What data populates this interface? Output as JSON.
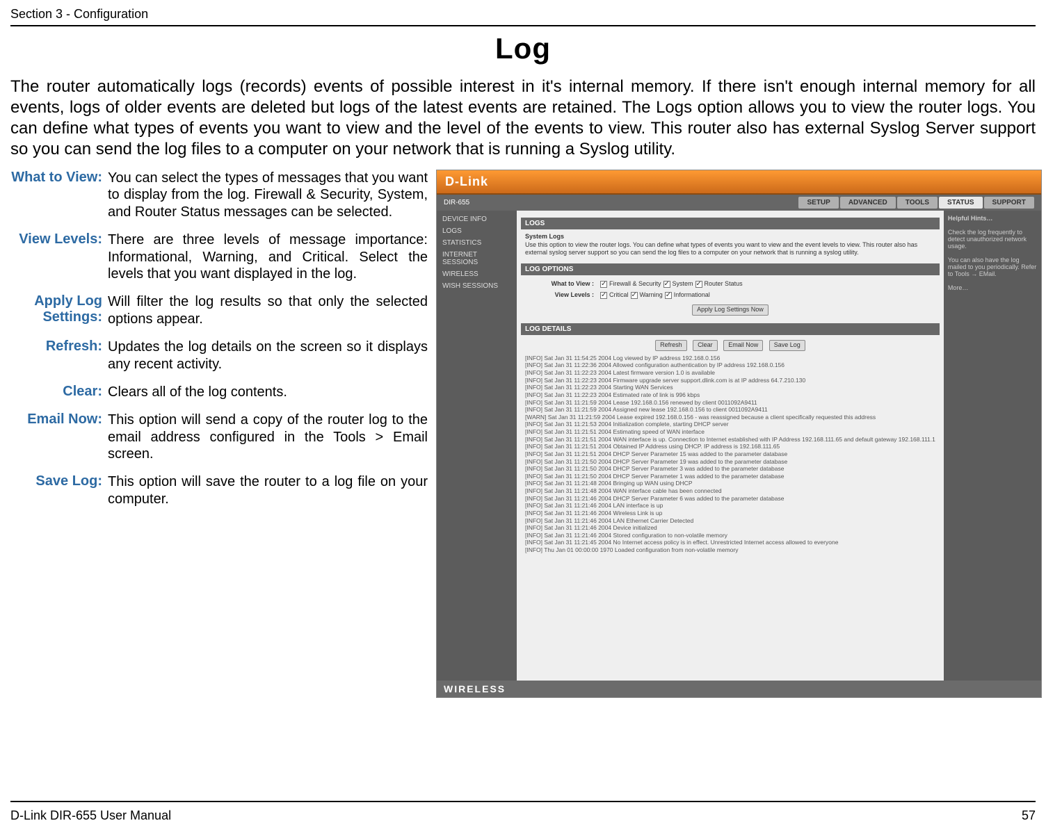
{
  "header": {
    "section": "Section 3 - Configuration"
  },
  "title": "Log",
  "intro": "The router automatically logs (records) events of possible interest in it's internal memory. If there isn't enough internal memory for all events, logs of older events are deleted but logs of the latest events are retained. The Logs option allows you to view the router logs. You can define what types of events you want to view and the level of the events to view. This router also has external Syslog Server support so you can send the log files to a computer on your network that is running a Syslog utility.",
  "defs": [
    {
      "label": "What to View:",
      "desc": "You can select the types of messages that you want to display from the log. Firewall & Security, System, and Router Status messages can be selected."
    },
    {
      "label": "View Levels:",
      "desc": "There are three levels of message importance: Informational, Warning, and Critical. Select the levels that you want displayed in the log."
    },
    {
      "label": "Apply Log Settings:",
      "desc": "Will filter the log results so that only the selected options appear."
    },
    {
      "label": "Refresh:",
      "desc": "Updates the log details on the screen so it displays any recent activity."
    },
    {
      "label": "Clear:",
      "desc": "Clears all of the log contents."
    },
    {
      "label": "Email Now:",
      "desc": "This option will send a copy of the router log to the email address configured in the Tools > Email screen."
    },
    {
      "label": "Save Log:",
      "desc": "This option will save the router to a log file on your computer."
    }
  ],
  "screenshot": {
    "brand": "D-Link",
    "model": "DIR-655",
    "tabs": [
      "SETUP",
      "ADVANCED",
      "TOOLS",
      "STATUS",
      "SUPPORT"
    ],
    "active_tab": "STATUS",
    "side_items": [
      "DEVICE INFO",
      "LOGS",
      "STATISTICS",
      "INTERNET SESSIONS",
      "WIRELESS",
      "WISH SESSIONS"
    ],
    "hints_title": "Helpful Hints…",
    "hints_body": "Check the log frequently to detect unauthorized network usage.\n\nYou can also have the log mailed to you periodically. Refer to Tools → EMail.\n\nMore…",
    "panel_logs_title": "LOGS",
    "panel_logs_sub": "System Logs",
    "panel_logs_desc": "Use this option to view the router logs. You can define what types of events you want to view and the event levels to view. This router also has external syslog server support so you can send the log files to a computer on your network that is running a syslog utility.",
    "panel_opt_title": "LOG OPTIONS",
    "what_to_view_label": "What to View :",
    "view_levels_label": "View Levels :",
    "chk_fw": "Firewall & Security",
    "chk_sys": "System",
    "chk_rs": "Router Status",
    "chk_crit": "Critical",
    "chk_warn": "Warning",
    "chk_info": "Informational",
    "btn_apply": "Apply Log Settings Now",
    "panel_det_title": "LOG DETAILS",
    "btn_refresh": "Refresh",
    "btn_clear": "Clear",
    "btn_email": "Email Now",
    "btn_save": "Save Log",
    "log_lines": [
      "[INFO] Sat Jan 31 11:54:25 2004 Log viewed by IP address 192.168.0.156",
      "[INFO] Sat Jan 31 11:22:36 2004 Allowed configuration authentication by IP address 192.168.0.156",
      "[INFO] Sat Jan 31 11:22:23 2004 Latest firmware version 1.0 is available",
      "[INFO] Sat Jan 31 11:22:23 2004 Firmware upgrade server support.dlink.com is at IP address 64.7.210.130",
      "[INFO] Sat Jan 31 11:22:23 2004 Starting WAN Services",
      "[INFO] Sat Jan 31 11:22:23 2004 Estimated rate of link is 996 kbps",
      "[INFO] Sat Jan 31 11:21:59 2004 Lease 192.168.0.156 renewed by client 0011092A9411",
      "[INFO] Sat Jan 31 11:21:59 2004 Assigned new lease 192.168.0.156 to client 0011092A9411",
      "[WARN] Sat Jan 31 11:21:59 2004 Lease expired 192.168.0.156 - was reassigned because a client specifically requested this address",
      "[INFO] Sat Jan 31 11:21:53 2004 Initialization complete, starting DHCP server",
      "[INFO] Sat Jan 31 11:21:51 2004 Estimating speed of WAN interface",
      "[INFO] Sat Jan 31 11:21:51 2004 WAN interface is up. Connection to Internet established with IP Address 192.168.111.65 and default gateway 192.168.111.1",
      "[INFO] Sat Jan 31 11:21:51 2004 Obtained IP Address using DHCP. IP address is 192.168.111.65",
      "[INFO] Sat Jan 31 11:21:51 2004 DHCP Server Parameter 15 was added to the parameter database",
      "[INFO] Sat Jan 31 11:21:50 2004 DHCP Server Parameter 19 was added to the parameter database",
      "[INFO] Sat Jan 31 11:21:50 2004 DHCP Server Parameter 3 was added to the parameter database",
      "[INFO] Sat Jan 31 11:21:50 2004 DHCP Server Parameter 1 was added to the parameter database",
      "[INFO] Sat Jan 31 11:21:48 2004 Bringing up WAN using DHCP",
      "[INFO] Sat Jan 31 11:21:48 2004 WAN interface cable has been connected",
      "[INFO] Sat Jan 31 11:21:46 2004 DHCP Server Parameter 6 was added to the parameter database",
      "[INFO] Sat Jan 31 11:21:46 2004 LAN interface is up",
      "[INFO] Sat Jan 31 11:21:46 2004 Wireless Link is up",
      "[INFO] Sat Jan 31 11:21:46 2004 LAN Ethernet Carrier Detected",
      "[INFO] Sat Jan 31 11:21:46 2004 Device initialized",
      "[INFO] Sat Jan 31 11:21:46 2004 Stored configuration to non-volatile memory",
      "[INFO] Sat Jan 31 11:21:45 2004 No Internet access policy is in effect. Unrestricted Internet access allowed to everyone",
      "[INFO] Thu Jan 01 00:00:00 1970 Loaded configuration from non-volatile memory"
    ],
    "footer_brand": "WIRELESS"
  },
  "footer": {
    "left": "D-Link DIR-655 User Manual",
    "right": "57"
  }
}
